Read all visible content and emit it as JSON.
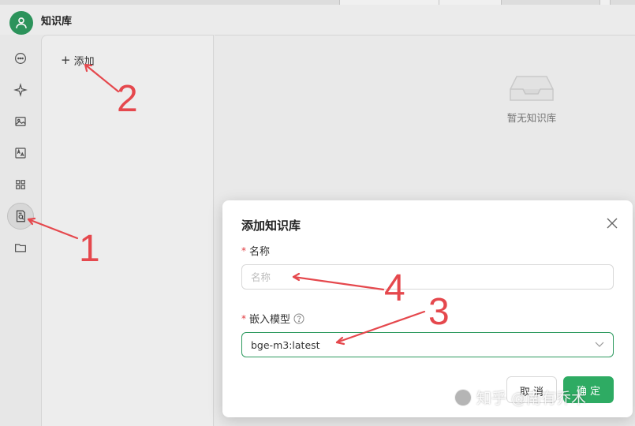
{
  "header": {
    "title": "知识库"
  },
  "sidebar": {
    "icons": [
      "chat-icon",
      "sparkle-icon",
      "image-icon",
      "translate-icon",
      "apps-icon",
      "knowledge-base-icon",
      "folder-icon"
    ]
  },
  "list_panel": {
    "add_label": "添加"
  },
  "main": {
    "empty_text": "暂无知识库"
  },
  "modal": {
    "title": "添加知识库",
    "name_label": "名称",
    "name_placeholder": "名称",
    "name_value": "",
    "model_label": "嵌入模型",
    "model_value": "bge-m3:latest",
    "cancel_label": "取 消",
    "ok_label": "确 定"
  },
  "annotations": [
    "1",
    "2",
    "3",
    "4"
  ],
  "watermark": {
    "text": "知乎 @南有乔木"
  },
  "colors": {
    "accent": "#2eab63",
    "annotation": "#e5484d",
    "required": "#e0393e"
  }
}
